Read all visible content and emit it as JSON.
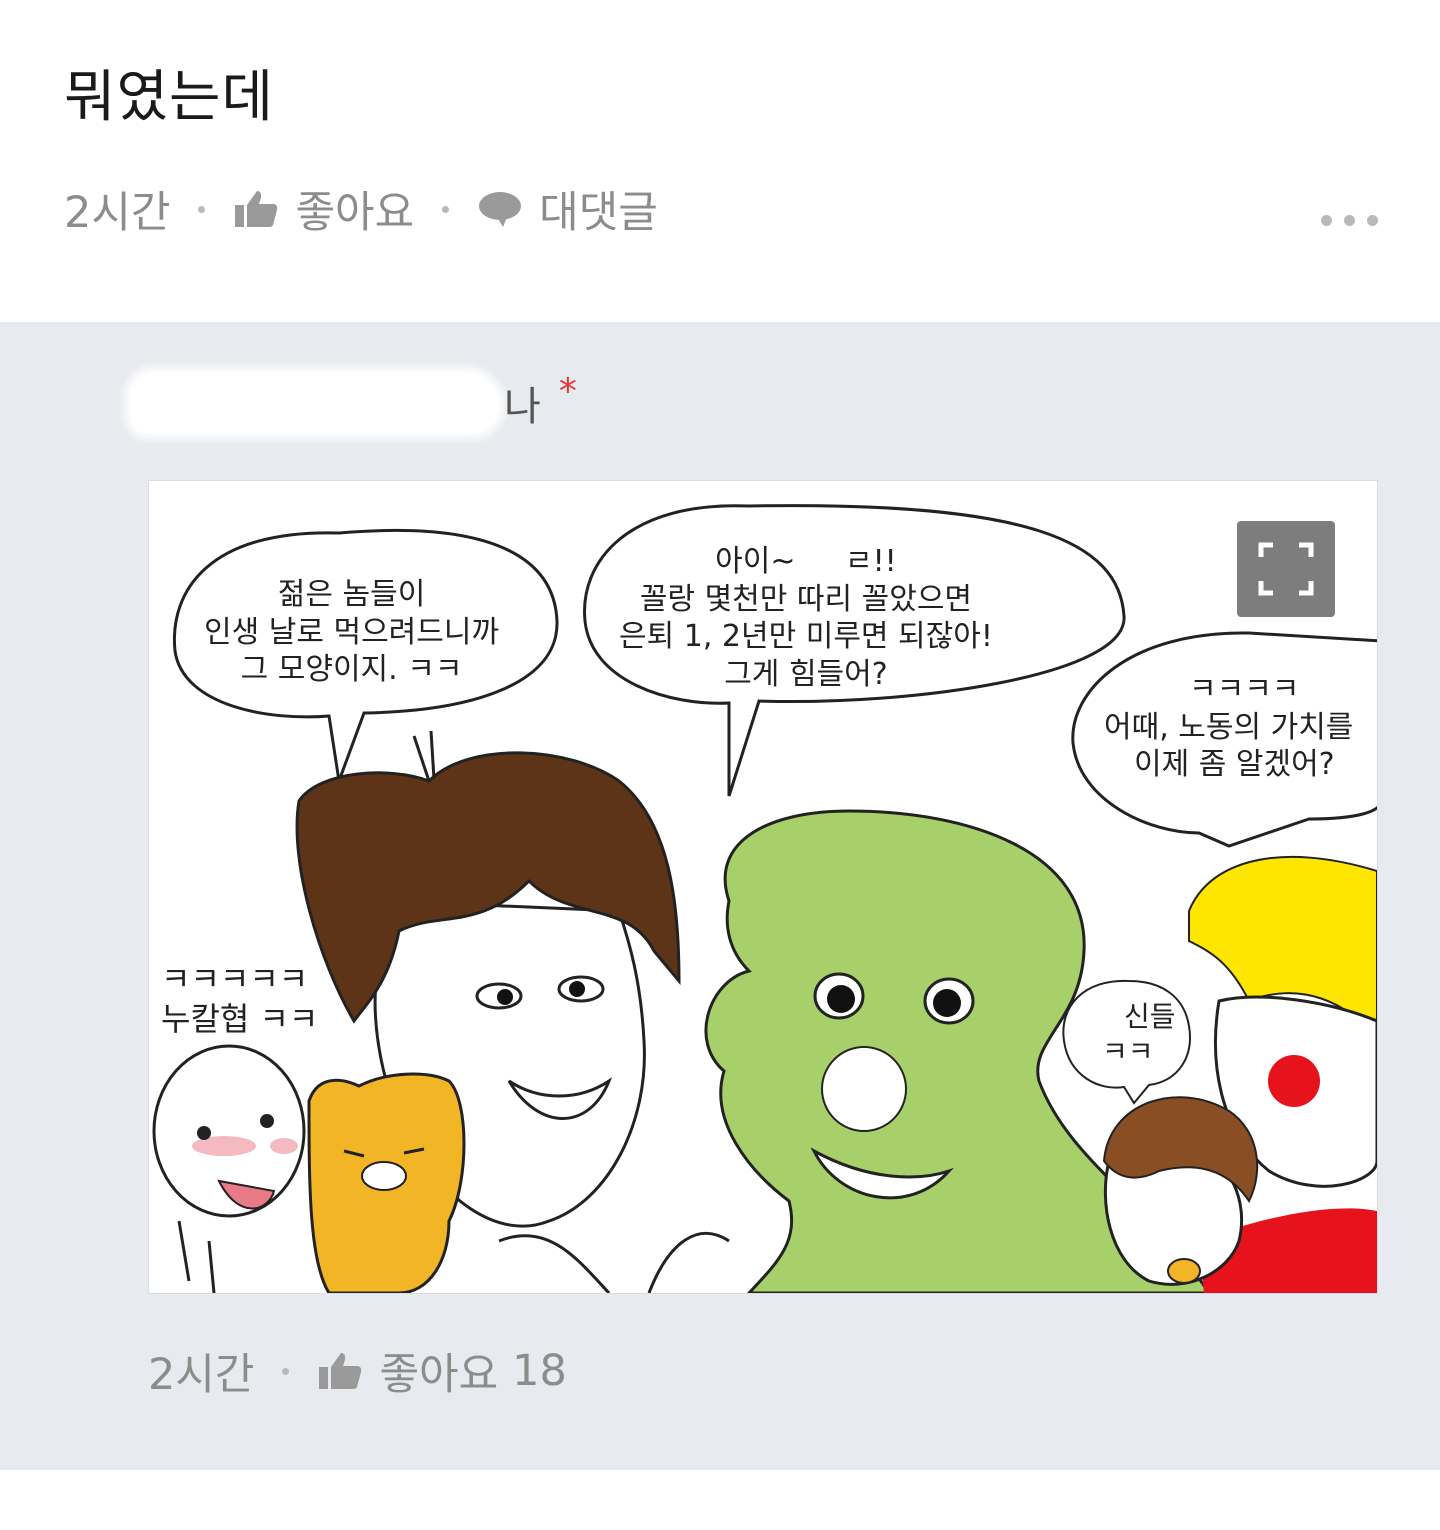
{
  "comment": {
    "text": "뭐였는데",
    "time": "2시간",
    "like_label": "좋아요",
    "reply_label": "대댓글"
  },
  "reply": {
    "author_suffix": "나",
    "author_mark": "*",
    "time": "2시간",
    "like_label": "좋아요",
    "like_count": "18"
  },
  "comic": {
    "bubble_left": [
      "젊은 놈들이",
      "인생 날로 먹으려드니까",
      "그 모양이지. ㅋㅋ"
    ],
    "bubble_center": [
      "아이~ ",
      "꼴랑 몇천만 따리 꼴았으면",
      "은퇴 1, 2년만 미루면 되잖아!",
      "그게 힘들어?"
    ],
    "bubble_center_tail": "ㄹ!!",
    "bubble_right": [
      "ㅋㅋㅋㅋ",
      "어때, 노동의 가치를",
      "이제 좀 알겠어?"
    ],
    "side_left": [
      "ㅋㅋㅋㅋㅋ",
      "누칼협 ㅋㅋ"
    ],
    "small_bubble": [
      "신들",
      "ㅋㅋ"
    ],
    "expand_icon": "expand-icon"
  }
}
